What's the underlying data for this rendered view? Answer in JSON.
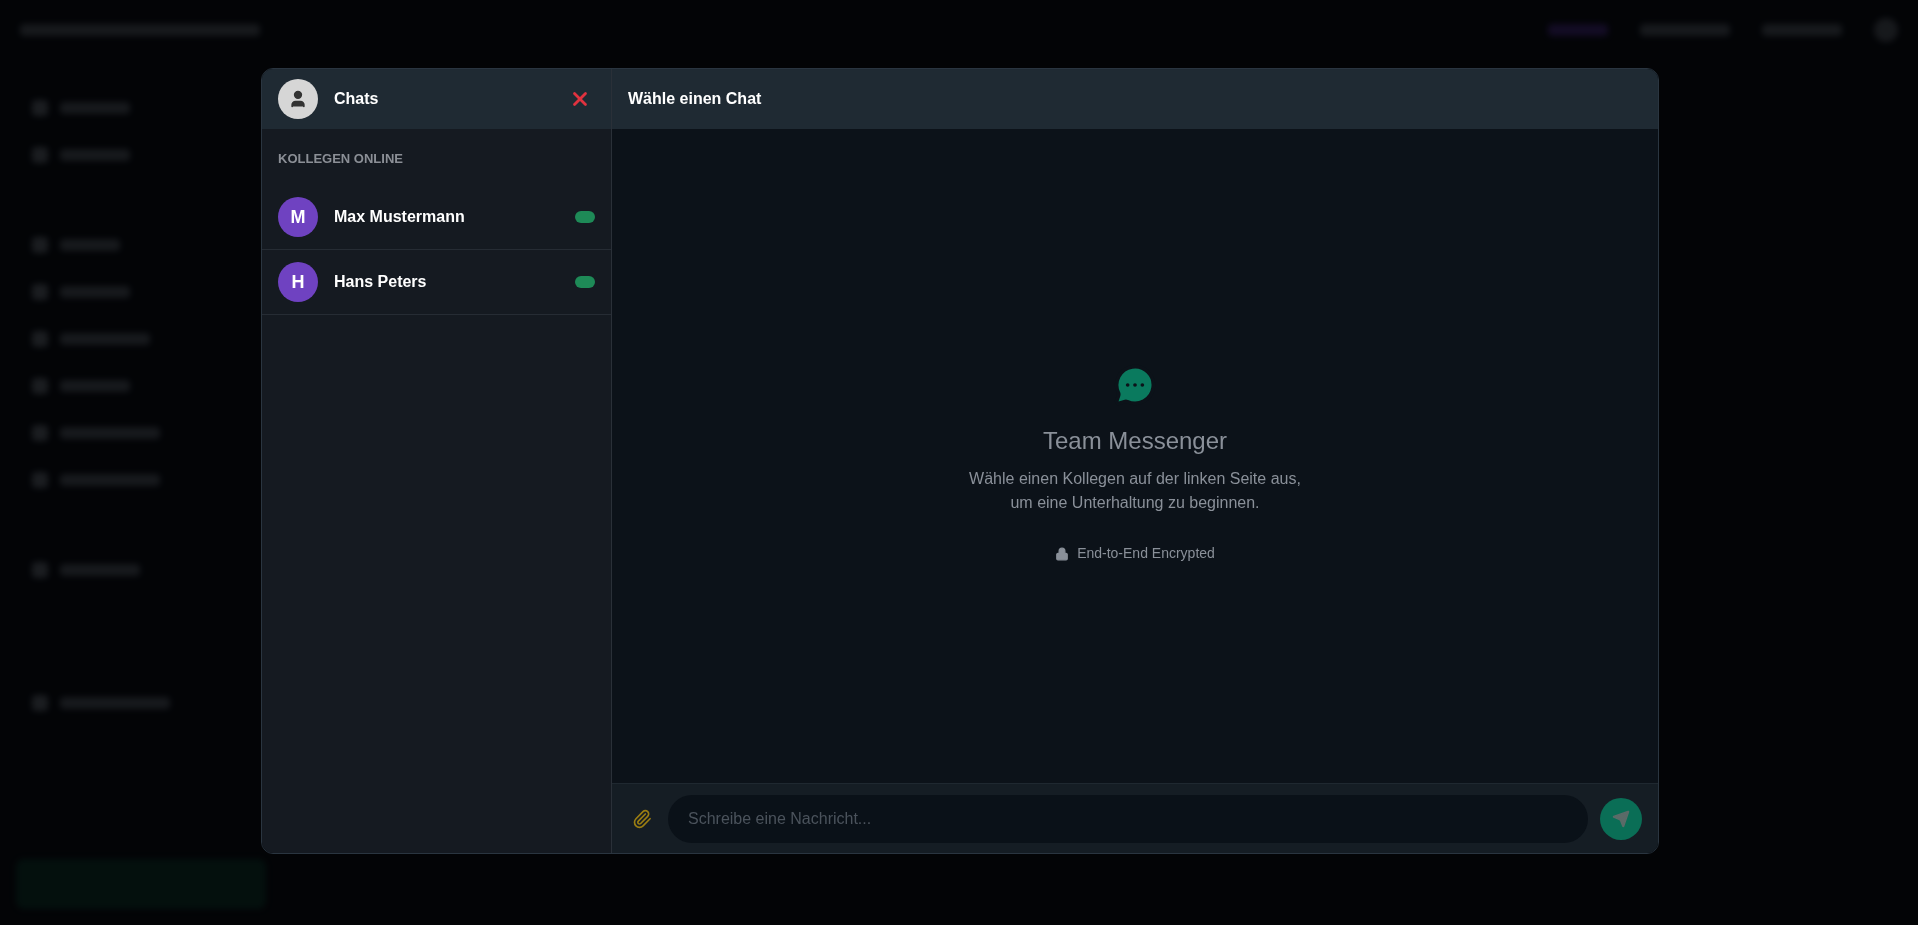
{
  "chat_window": {
    "sidebar_title": "Chats",
    "chat_title": "Wähle einen Chat",
    "section_label": "KOLLEGEN ONLINE",
    "contacts": [
      {
        "initial": "M",
        "name": "Max Mustermann",
        "online": true
      },
      {
        "initial": "H",
        "name": "Hans Peters",
        "online": true
      }
    ],
    "empty_state": {
      "title": "Team Messenger",
      "lines": [
        "Wähle einen Kollegen auf der linken Seite aus,",
        "um eine Unterhaltung zu beginnen."
      ],
      "security_note": "End-to-End Encrypted"
    },
    "composer": {
      "placeholder": "Schreibe eine Nachricht..."
    }
  }
}
